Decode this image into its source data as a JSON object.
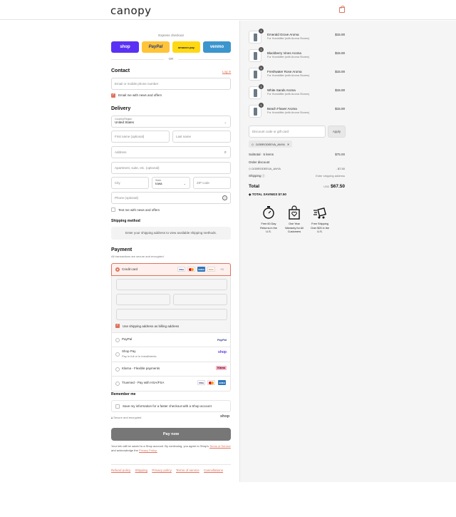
{
  "brand": {
    "logo_text": "canopy",
    "accent": "#e0725d"
  },
  "express": {
    "title": "Express checkout",
    "buttons": [
      {
        "label": "shop",
        "color": "#5a31f4"
      },
      {
        "label": "PayPal",
        "color": "#ffc439"
      },
      {
        "label": "amazon pay",
        "color": "#ffd814"
      },
      {
        "label": "venmo",
        "color": "#3d95ce"
      }
    ],
    "or": "OR"
  },
  "contact": {
    "title": "Contact",
    "login": "Log in",
    "placeholder": "Email or mobile phone number",
    "news": "Email me with news and offers"
  },
  "delivery": {
    "title": "Delivery",
    "country_label": "Country/Region",
    "country_value": "United States",
    "first_name": "First name (optional)",
    "last_name": "Last name",
    "address": "Address",
    "apartment": "Apartment, suite, etc. (optional)",
    "city": "City",
    "state_label": "State",
    "state_value": "Iowa",
    "zip": "ZIP code",
    "phone": "Phone (optional)",
    "text_news": "Text me with news and offers"
  },
  "shipping": {
    "title": "Shipping method",
    "info": "Enter your shipping address to view available shipping methods."
  },
  "payment": {
    "title": "Payment",
    "subtitle": "All transactions are secure and encrypted.",
    "credit_card": "Credit card",
    "card_brands": [
      "VISA",
      "MC",
      "AMEX",
      "DISC",
      "+3"
    ],
    "billing": "Use shipping address as billing address",
    "methods": [
      {
        "label": "PayPal",
        "sub": "",
        "badge": "PayPal"
      },
      {
        "label": "Shop Pay",
        "sub": "Pay in full or in installments",
        "badge": "shop"
      },
      {
        "label": "Klarna - Flexible payments",
        "sub": "",
        "badge": "Klarna"
      },
      {
        "label": "Truemed - Pay with HSA/FSA",
        "sub": "",
        "badge": "VISA MC AMEX"
      }
    ]
  },
  "remember": {
    "title": "Remember me",
    "save": "Save my information for a faster checkout with a Shop account",
    "secure": "Secure and encrypted",
    "shop": "shop"
  },
  "pay_now": "Pay now",
  "terms": {
    "text1": "Your info will be saved to a Shop account. By continuing, you agree to Shop's",
    "tos": "Terms of Service",
    "text2": "and acknowledge the",
    "privacy": "Privacy Policy."
  },
  "footer": [
    "Refund policy",
    "Shipping",
    "Privacy policy",
    "Terms of service",
    "Cancellations"
  ],
  "cart": {
    "items": [
      {
        "name": "Emerald Grove Aroma",
        "sub": "For Humidifier (with Aroma Stones)",
        "price": "$15.00",
        "qty": "1"
      },
      {
        "name": "Blackberry Vines Aroma",
        "sub": "For Humidifier (with Aroma Stones)",
        "price": "$15.00",
        "qty": "1"
      },
      {
        "name": "Freshwater Rose Aroma",
        "sub": "For Humidifier (with Aroma Stones)",
        "price": "$15.00",
        "qty": "1"
      },
      {
        "name": "White Sands Aroma",
        "sub": "For Humidifier (with Aroma Stones)",
        "price": "$15.00",
        "qty": "1"
      },
      {
        "name": "Beach Flower Aroma",
        "sub": "For Humidifier (with Aroma Stones)",
        "price": "$15.00",
        "qty": "1"
      }
    ],
    "discount_placeholder": "Discount code or gift card",
    "apply": "Apply",
    "code": "DOBRODEEVA_ANYA",
    "subtotal_label": "Subtotal · 5 items",
    "subtotal": "$75.00",
    "order_discount": "Order discount",
    "discount_code": "DOBRODEEVA_ANYA",
    "discount_value": "- $7.50",
    "shipping_label": "Shipping",
    "shipping_value": "Enter shipping address",
    "total_label": "Total",
    "currency": "USD",
    "total": "$67.50",
    "savings_label": "TOTAL SAVINGS",
    "savings": "$7.50",
    "perks": [
      {
        "l1": "Free 60 Day",
        "l2": "Returns in the",
        "l3": "U.S."
      },
      {
        "l1": "One Year",
        "l2": "Warranty for All",
        "l3": "Customers"
      },
      {
        "l1": "Free Shipping",
        "l2": "Over $25 in the",
        "l3": "U.S."
      }
    ]
  }
}
